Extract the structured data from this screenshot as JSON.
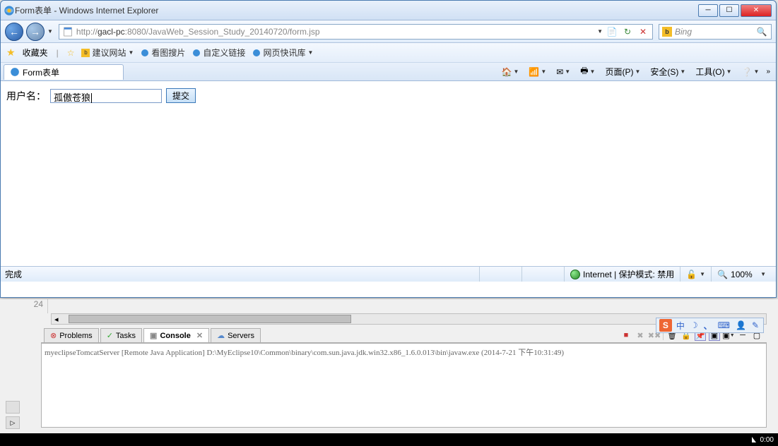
{
  "window": {
    "title": "Form表单 - Windows Internet Explorer"
  },
  "nav": {
    "url_prefix": "http://",
    "url_host": "gacl-pc",
    "url_port": ":8080",
    "url_path": "/JavaWeb_Session_Study_20140720/form.jsp",
    "search_engine": "Bing"
  },
  "favbar": {
    "label": "收藏夹",
    "items": [
      {
        "icon": "b",
        "label": "建议网站",
        "dropdown": true
      },
      {
        "icon": "e",
        "label": "看图搜片",
        "dropdown": false
      },
      {
        "icon": "e",
        "label": "自定义链接",
        "dropdown": false
      },
      {
        "icon": "e",
        "label": "网页快讯库",
        "dropdown": true
      }
    ]
  },
  "tab": {
    "title": "Form表单"
  },
  "tabmenu": {
    "page": "页面(P)",
    "safety": "安全(S)",
    "tools": "工具(O)"
  },
  "form": {
    "label": "用户名：",
    "value": "孤傲苍狼",
    "submit": "提交"
  },
  "status": {
    "left": "完成",
    "zone": "Internet | 保护模式: 禁用",
    "zoom": "100%"
  },
  "eclipse": {
    "line": "24",
    "tabs": [
      "Problems",
      "Tasks",
      "Console",
      "Servers"
    ],
    "active_tab": 2,
    "console_header": "myeclipseTomcatServer [Remote Java Application] D:\\MyEclipse10\\Common\\binary\\com.sun.java.jdk.win32.x86_1.6.0.013\\bin\\javaw.exe (2014-7-21 下午10:31:49)"
  },
  "ime": {
    "items": [
      "中",
      "",
      "、",
      "",
      "",
      ""
    ]
  },
  "taskbar": {
    "time": "0:00"
  }
}
